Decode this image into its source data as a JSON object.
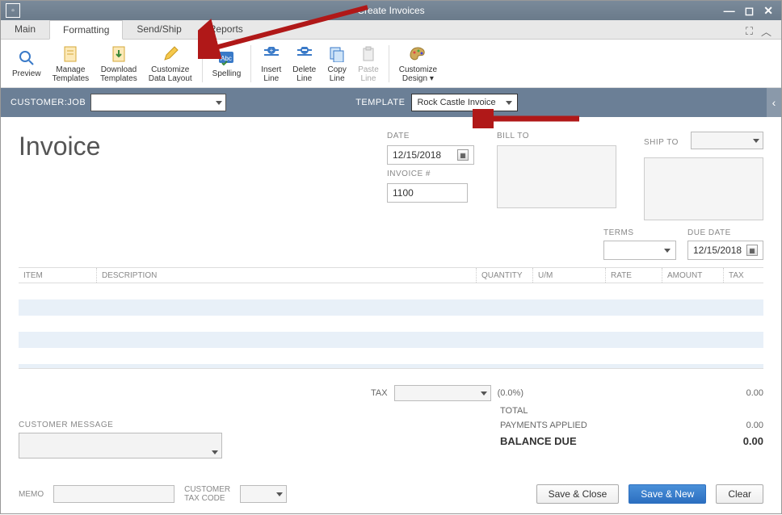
{
  "window": {
    "title": "Create Invoices"
  },
  "tabs": {
    "main": "Main",
    "formatting": "Formatting",
    "sendship": "Send/Ship",
    "reports": "Reports"
  },
  "ribbon": {
    "preview": "Preview",
    "manage_templates": "Manage\nTemplates",
    "download_templates": "Download\nTemplates",
    "customize_layout": "Customize\nData Layout",
    "spelling": "Spelling",
    "insert_line": "Insert\nLine",
    "delete_line": "Delete\nLine",
    "copy_line": "Copy\nLine",
    "paste_line": "Paste\nLine",
    "customize_design": "Customize\nDesign"
  },
  "bar": {
    "customer_label": "CUSTOMER:JOB",
    "template_label": "TEMPLATE",
    "template_value": "Rock Castle Invoice"
  },
  "header": {
    "title": "Invoice",
    "date_label": "DATE",
    "date_value": "12/15/2018",
    "invoice_label": "INVOICE #",
    "invoice_value": "1100",
    "billto_label": "BILL TO",
    "shipto_label": "SHIP TO",
    "terms_label": "TERMS",
    "duedate_label": "DUE DATE",
    "duedate_value": "12/15/2018"
  },
  "grid": {
    "cols": {
      "item": "ITEM",
      "desc": "DESCRIPTION",
      "qty": "QUANTITY",
      "um": "U/M",
      "rate": "RATE",
      "amount": "AMOUNT",
      "tax": "TAX"
    }
  },
  "totals": {
    "tax_label": "TAX",
    "tax_pct": "(0.0%)",
    "tax_amt": "0.00",
    "total_label": "TOTAL",
    "pay_applied_label": "PAYMENTS APPLIED",
    "pay_applied_amt": "0.00",
    "balance_label": "BALANCE DUE",
    "balance_amt": "0.00"
  },
  "footer": {
    "cust_msg_label": "CUSTOMER MESSAGE",
    "memo_label": "MEMO",
    "taxcode_label": "CUSTOMER\nTAX CODE",
    "save_close": "Save & Close",
    "save_new": "Save & New",
    "clear": "Clear"
  }
}
